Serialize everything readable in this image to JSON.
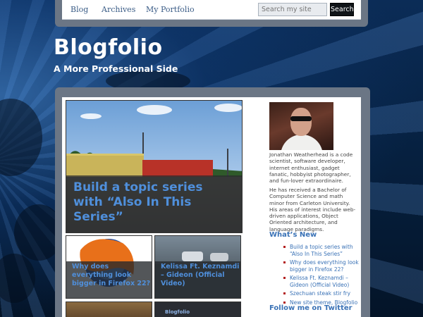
{
  "nav": {
    "items": [
      "Blog",
      "Archives",
      "My Portfolio"
    ],
    "search_placeholder": "Search my site",
    "search_button": "Search"
  },
  "header": {
    "title": "Blogfolio",
    "tagline": "A More Professional Side"
  },
  "featured": {
    "title": "Build a topic series with “Also In This Series”"
  },
  "posts": [
    {
      "title": "Why does everything look bigger in Firefox 22?"
    },
    {
      "title": "Kelissa Ft. Keznamdi – Gideon (Official Video)"
    },
    {
      "title": ""
    },
    {
      "title": "Blogfolio"
    }
  ],
  "sidebar": {
    "bio_1": "Jonathan Weatherhead is a code scientist, software developer, internet enthusiast, gadget fanatic, hobbyist photographer, and fun-lover extraordinaire.",
    "bio_2": "He has received a Bachelor of Computer Science and math minor from Carleton University. His areas of interest include web-driven applications, Object Oriented architecture, and language paradigms.",
    "whats_new_heading": "What’s New",
    "whats_new": [
      "Build a topic series with “Also In This Series”",
      "Why does everything look bigger in Firefox 22?",
      "Kelissa Ft. Keznamdi – Gideon (Official Video)",
      "Szechuan steak stir fry",
      "New site theme, Blogfolio"
    ],
    "follow_heading": "Follow me on Twitter"
  },
  "colors": {
    "accent": "#3a72b6",
    "background": "#061a33"
  }
}
